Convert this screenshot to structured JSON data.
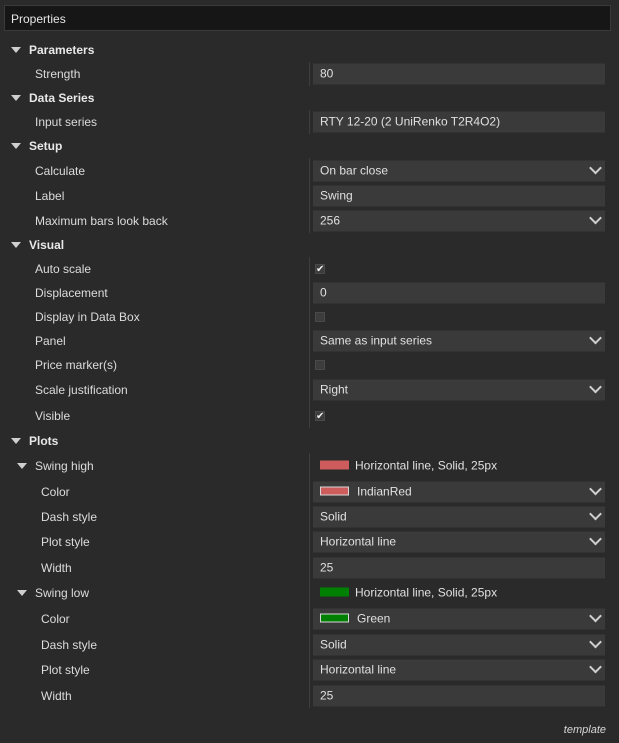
{
  "window": {
    "title": "Properties"
  },
  "sections": {
    "parameters": {
      "label": "Parameters",
      "strength": {
        "label": "Strength",
        "value": "80"
      }
    },
    "data_series": {
      "label": "Data Series",
      "input_series": {
        "label": "Input series",
        "value": "RTY 12-20 (2 UniRenko T2R4O2)"
      }
    },
    "setup": {
      "label": "Setup",
      "calculate": {
        "label": "Calculate",
        "value": "On bar close"
      },
      "name": {
        "label": "Label",
        "value": "Swing"
      },
      "max_bars": {
        "label": "Maximum bars look back",
        "value": "256"
      }
    },
    "visual": {
      "label": "Visual",
      "auto_scale": {
        "label": "Auto scale",
        "checked": true,
        "mark": "✔"
      },
      "displacement": {
        "label": "Displacement",
        "value": "0"
      },
      "display_data_box": {
        "label": "Display in Data Box",
        "checked": false,
        "mark": ""
      },
      "panel": {
        "label": "Panel",
        "value": "Same as input series"
      },
      "price_markers": {
        "label": "Price marker(s)",
        "checked": false,
        "mark": ""
      },
      "scale_justification": {
        "label": "Scale justification",
        "value": "Right"
      },
      "visible": {
        "label": "Visible",
        "checked": true,
        "mark": "✔"
      }
    },
    "plots": {
      "label": "Plots",
      "swing_high": {
        "label": "Swing high",
        "summary": "Horizontal line, Solid, 25px",
        "swatch_color": "#cd5c5c",
        "color": {
          "label": "Color",
          "value": "IndianRed"
        },
        "dash_style": {
          "label": "Dash style",
          "value": "Solid"
        },
        "plot_style": {
          "label": "Plot style",
          "value": "Horizontal line"
        },
        "width": {
          "label": "Width",
          "value": "25"
        }
      },
      "swing_low": {
        "label": "Swing low",
        "summary": "Horizontal line, Solid, 25px",
        "swatch_color": "#008000",
        "color": {
          "label": "Color",
          "value": "Green"
        },
        "dash_style": {
          "label": "Dash style",
          "value": "Solid"
        },
        "plot_style": {
          "label": "Plot style",
          "value": "Horizontal line"
        },
        "width": {
          "label": "Width",
          "value": "25"
        }
      }
    }
  },
  "footer": {
    "text": "template"
  }
}
